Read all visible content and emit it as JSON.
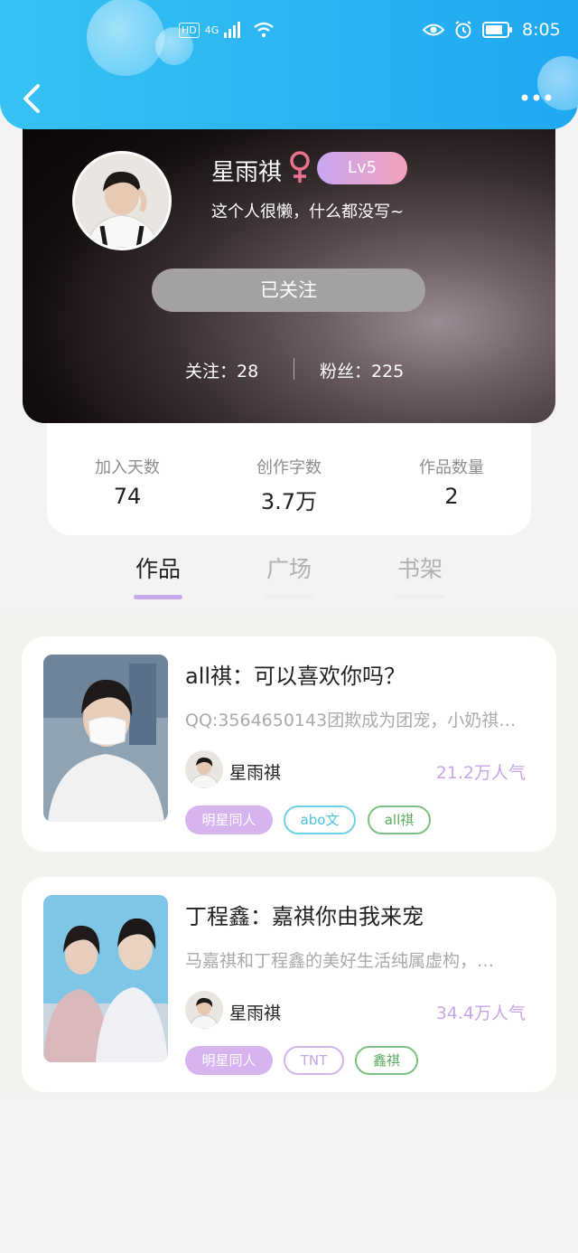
{
  "status_bar": {
    "time": "8:05",
    "network": "HD 4G"
  },
  "profile": {
    "name": "星雨祺",
    "gender_symbol": "♀",
    "level": "Lv5",
    "bio": "这个人很懒，什么都没写~",
    "follow_button": "已关注",
    "following_label": "关注：28",
    "followers_label": "粉丝：225"
  },
  "stats": [
    {
      "label": "加入天数",
      "value": "74"
    },
    {
      "label": "创作字数",
      "value": "3.7万"
    },
    {
      "label": "作品数量",
      "value": "2"
    }
  ],
  "tabs": [
    "作品",
    "广场",
    "书架"
  ],
  "works": [
    {
      "title": "all祺：可以喜欢你吗？",
      "desc": "QQ:3564650143团欺成为团宠，小奶祺…",
      "author": "星雨祺",
      "popularity": "21.2万人气",
      "tags": [
        "明星同人",
        "abo文",
        "all祺"
      ]
    },
    {
      "title": "丁程鑫：嘉祺你由我来宠",
      "desc": "马嘉祺和丁程鑫的美好生活纯属虚构，…",
      "author": "星雨祺",
      "popularity": "34.4万人气",
      "tags": [
        "明星同人",
        "TNT",
        "鑫祺"
      ]
    }
  ],
  "colors": {
    "header": "#1fa8f1",
    "accent_purple": "#c9a8ea",
    "tag_filled_bg": "#d7b4f0",
    "tag_cyan": "#6fd1e6",
    "tag_green": "#7cc07f"
  }
}
